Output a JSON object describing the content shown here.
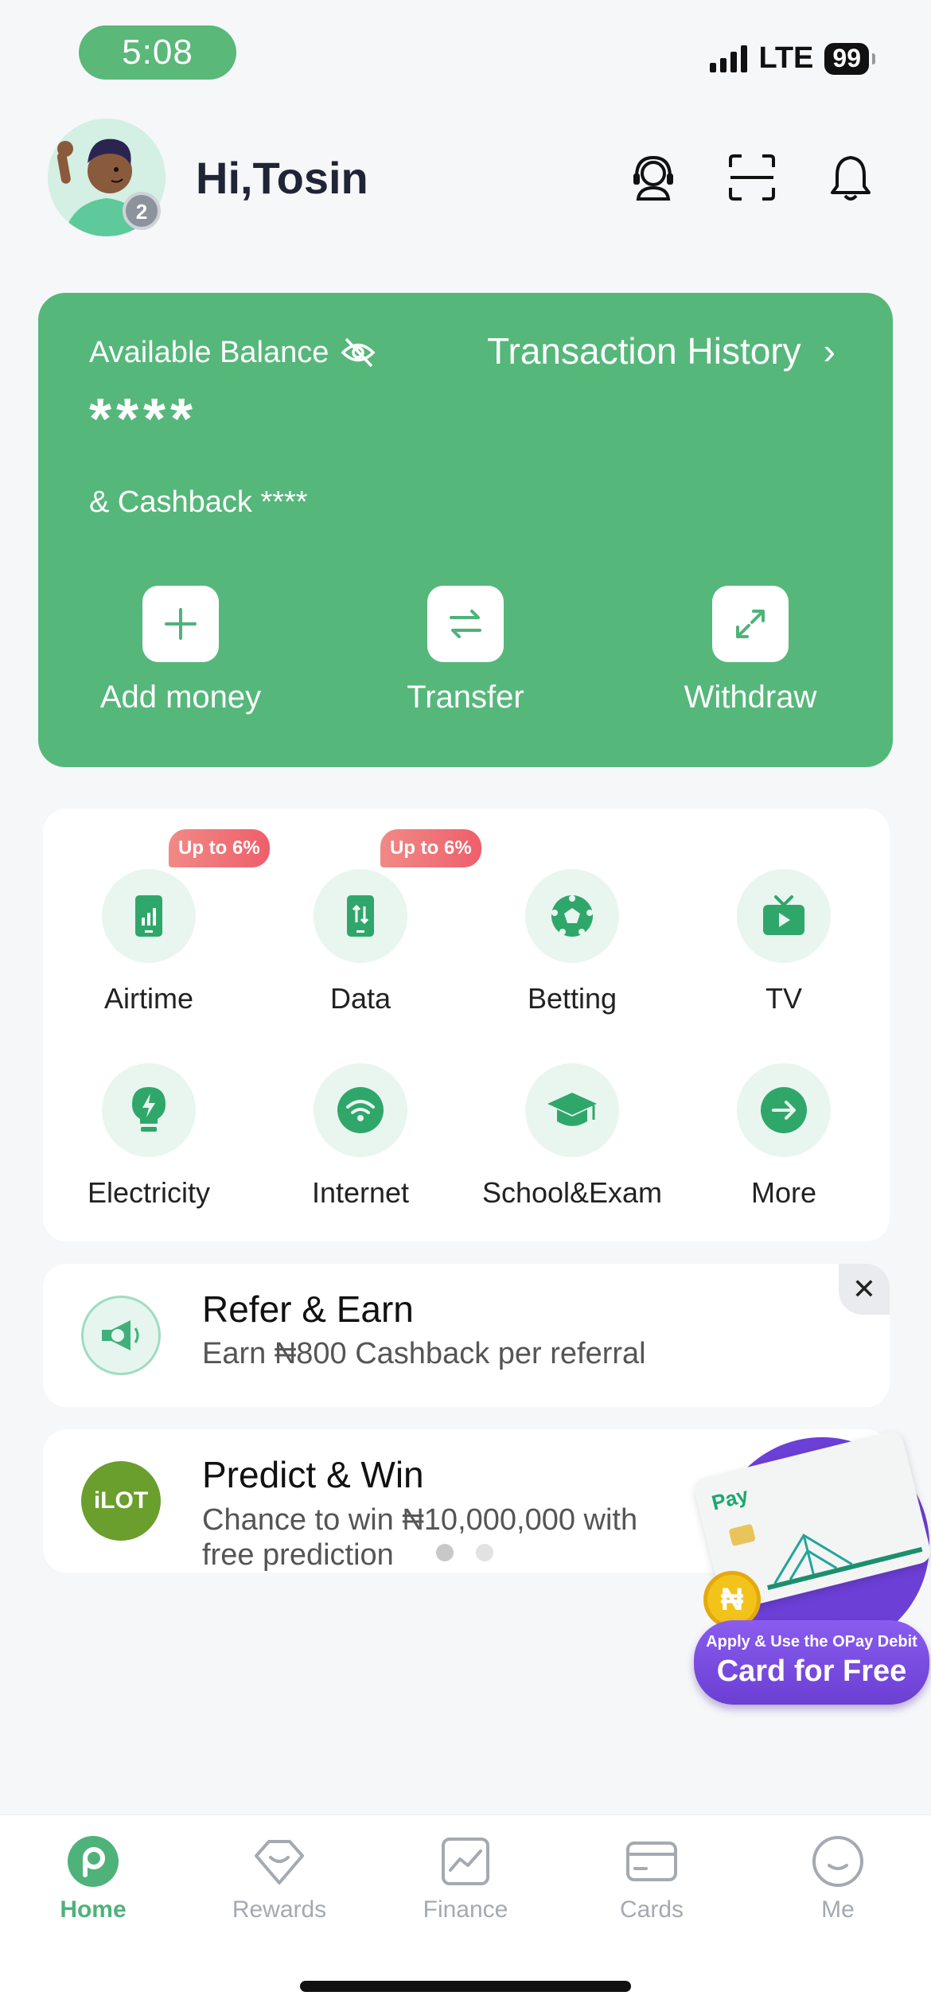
{
  "status_bar": {
    "time": "5:08",
    "network": "LTE",
    "battery": "99"
  },
  "header": {
    "greeting": "Hi,Tosin",
    "avatar_badge": "2"
  },
  "balance_card": {
    "label": "Available Balance",
    "transaction_history": "Transaction History",
    "chevron": "›",
    "balance_value": "****",
    "cashback": "& Cashback ****",
    "actions": [
      {
        "label": "Add money",
        "icon": "plus-icon"
      },
      {
        "label": "Transfer",
        "icon": "transfer-icon"
      },
      {
        "label": "Withdraw",
        "icon": "withdraw-icon"
      }
    ]
  },
  "services": {
    "items": [
      {
        "label": "Airtime",
        "badge": "Up to 6%",
        "icon": "airtime-icon"
      },
      {
        "label": "Data",
        "badge": "Up to 6%",
        "icon": "data-icon"
      },
      {
        "label": "Betting",
        "icon": "betting-icon"
      },
      {
        "label": "TV",
        "icon": "tv-icon"
      },
      {
        "label": "Electricity",
        "icon": "electricity-icon"
      },
      {
        "label": "Internet",
        "icon": "internet-icon"
      },
      {
        "label": "School&Exam",
        "icon": "school-icon"
      },
      {
        "label": "More",
        "icon": "more-icon"
      }
    ]
  },
  "refer": {
    "title": "Refer & Earn",
    "subtitle": "Earn ₦800 Cashback per referral",
    "close": "✕"
  },
  "predict": {
    "title": "Predict & Win",
    "subtitle": "Chance to win ₦10,000,000 with free prediction",
    "logo": "iLOT"
  },
  "promo": {
    "line1": "Apply & Use the OPay Debit",
    "line2": "Card for Free",
    "brand": "Pay",
    "coin": "₦"
  },
  "bottom_nav": {
    "items": [
      {
        "label": "Home",
        "active": true
      },
      {
        "label": "Rewards",
        "active": false
      },
      {
        "label": "Finance",
        "active": false
      },
      {
        "label": "Cards",
        "active": false
      },
      {
        "label": "Me",
        "active": false
      }
    ]
  },
  "colors": {
    "brand_green": "#56b77b",
    "accent_green": "#4fb27a",
    "promo_purple": "#6c3fd6",
    "badge_red": "#ee5f6a"
  }
}
